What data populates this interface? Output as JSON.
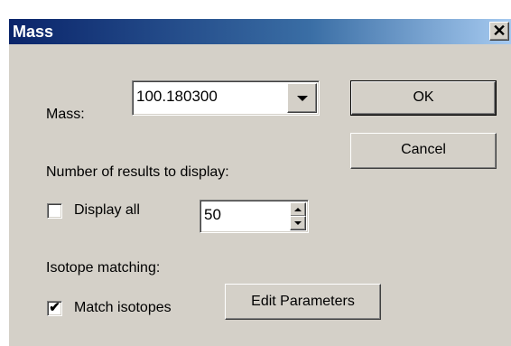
{
  "window": {
    "title": "Mass",
    "close_glyph": "✕"
  },
  "mass": {
    "label": "Mass:",
    "value": "100.180300"
  },
  "results": {
    "label": "Number of results to display:",
    "display_all_label": "Display all",
    "display_all_checked": false,
    "count_value": "50"
  },
  "isotope": {
    "label": "Isotope matching:",
    "match_label": "Match isotopes",
    "match_checked": true,
    "check_glyph": "✔",
    "edit_button_label": "Edit Parameters"
  },
  "buttons": {
    "ok_label": "OK",
    "cancel_label": "Cancel"
  },
  "icons": {
    "close": "close-icon",
    "dropdown": "chevron-down-icon",
    "spin_up": "spin-up-icon",
    "spin_down": "spin-down-icon",
    "check": "checkmark-icon"
  },
  "colors": {
    "dialog_face": "#d4d0c8",
    "title_start": "#0a246a",
    "title_end": "#a6caf0",
    "title_text": "#ffffff"
  }
}
